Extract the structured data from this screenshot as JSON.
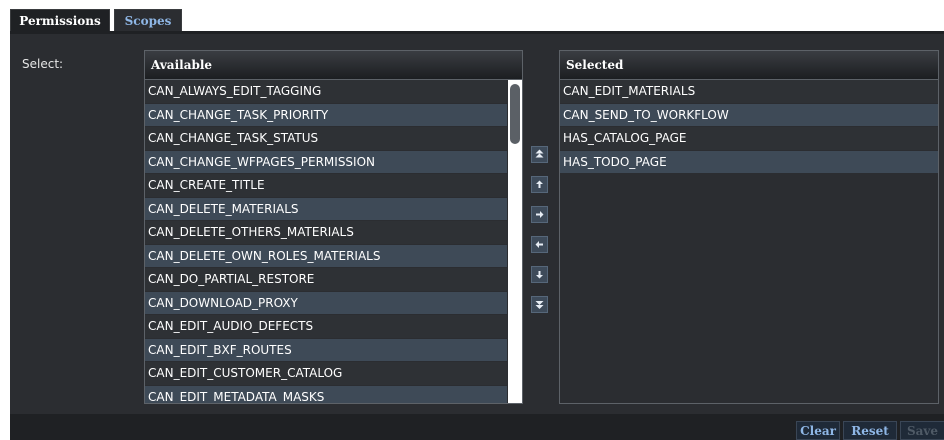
{
  "tabs": [
    {
      "label": "Permissions",
      "active": true
    },
    {
      "label": "Scopes",
      "active": false
    }
  ],
  "select_label": "Select:",
  "available": {
    "header": "Available",
    "items": [
      "CAN_ALWAYS_EDIT_TAGGING",
      "CAN_CHANGE_TASK_PRIORITY",
      "CAN_CHANGE_TASK_STATUS",
      "CAN_CHANGE_WFPAGES_PERMISSION",
      "CAN_CREATE_TITLE",
      "CAN_DELETE_MATERIALS",
      "CAN_DELETE_OTHERS_MATERIALS",
      "CAN_DELETE_OWN_ROLES_MATERIALS",
      "CAN_DO_PARTIAL_RESTORE",
      "CAN_DOWNLOAD_PROXY",
      "CAN_EDIT_AUDIO_DEFECTS",
      "CAN_EDIT_BXF_ROUTES",
      "CAN_EDIT_CUSTOMER_CATALOG",
      "CAN_EDIT_METADATA_MASKS"
    ]
  },
  "selected": {
    "header": "Selected",
    "items": [
      "CAN_EDIT_MATERIALS",
      "CAN_SEND_TO_WORKFLOW",
      "HAS_CATALOG_PAGE",
      "HAS_TODO_PAGE"
    ]
  },
  "move_buttons": [
    {
      "icon": "move-top-icon"
    },
    {
      "icon": "move-up-icon"
    },
    {
      "icon": "move-right-icon"
    },
    {
      "icon": "move-left-icon"
    },
    {
      "icon": "move-down-icon"
    },
    {
      "icon": "move-bottom-icon"
    }
  ],
  "footer": {
    "clear_label": "Clear",
    "reset_label": "Reset",
    "save_label": "Save"
  },
  "colors": {
    "panel_bg": "#2b2d31",
    "row_alt": "#3e4a57",
    "link_blue": "#8fb7e6",
    "button_bg": "#3e4b5a"
  }
}
